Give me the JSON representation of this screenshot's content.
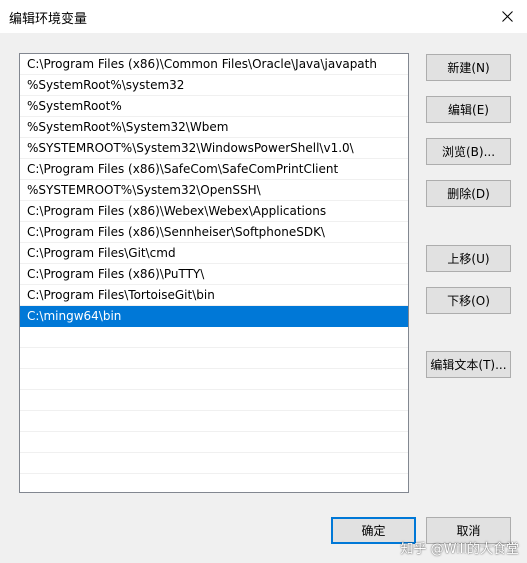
{
  "window": {
    "title": "编辑环境变量"
  },
  "paths": [
    "C:\\Program Files (x86)\\Common Files\\Oracle\\Java\\javapath",
    "%SystemRoot%\\system32",
    "%SystemRoot%",
    "%SystemRoot%\\System32\\Wbem",
    "%SYSTEMROOT%\\System32\\WindowsPowerShell\\v1.0\\",
    "C:\\Program Files (x86)\\SafeCom\\SafeComPrintClient",
    "%SYSTEMROOT%\\System32\\OpenSSH\\",
    "C:\\Program Files (x86)\\Webex\\Webex\\Applications",
    "C:\\Program Files (x86)\\Sennheiser\\SoftphoneSDK\\",
    "C:\\Program Files\\Git\\cmd",
    "C:\\Program Files (x86)\\PuTTY\\",
    "C:\\Program Files\\TortoiseGit\\bin",
    "C:\\mingw64\\bin",
    "",
    "",
    "",
    "",
    "",
    "",
    "",
    ""
  ],
  "selected_index": 12,
  "buttons": {
    "new": "新建(N)",
    "edit": "编辑(E)",
    "browse": "浏览(B)...",
    "delete": "删除(D)",
    "move_up": "上移(U)",
    "move_down": "下移(O)",
    "edit_text": "编辑文本(T)...",
    "ok": "确定",
    "cancel": "取消"
  },
  "watermark": "知乎 @Will的大食堂",
  "colors": {
    "selection": "#0078d7",
    "default_button_border": "#0078d7"
  }
}
